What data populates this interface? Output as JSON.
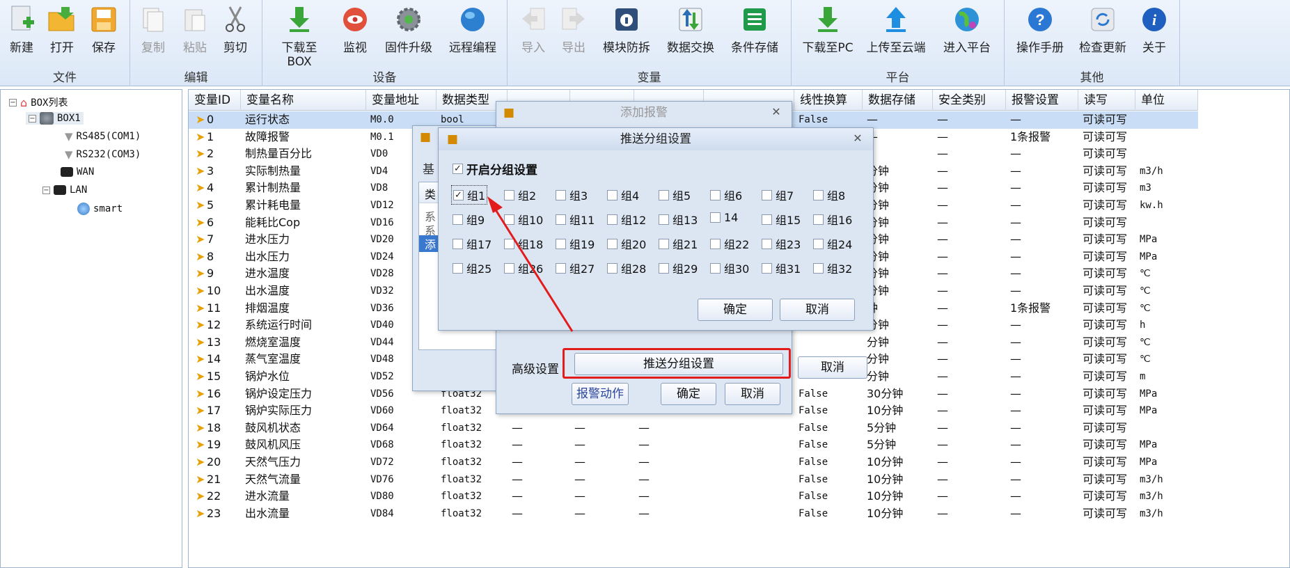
{
  "ribbon": {
    "groups": [
      {
        "name": "文件",
        "buttons": [
          {
            "label": "新建",
            "icon": "new-file-icon"
          },
          {
            "label": "打开",
            "icon": "open-folder-icon"
          },
          {
            "label": "保存",
            "icon": "save-icon"
          }
        ]
      },
      {
        "name": "编辑",
        "buttons": [
          {
            "label": "复制",
            "icon": "copy-icon"
          },
          {
            "label": "粘贴",
            "icon": "paste-icon"
          },
          {
            "label": "剪切",
            "icon": "scissors-icon"
          }
        ]
      },
      {
        "name": "设备",
        "buttons": [
          {
            "label": "下载至BOX",
            "icon": "download-icon"
          },
          {
            "label": "监视",
            "icon": "eye-icon"
          },
          {
            "label": "固件升级",
            "icon": "gear-icon"
          },
          {
            "label": "远程编程",
            "icon": "globe-icon"
          }
        ]
      },
      {
        "name": "变量",
        "buttons": [
          {
            "label": "导入",
            "icon": "import-icon"
          },
          {
            "label": "导出",
            "icon": "export-icon"
          },
          {
            "label": "模块防拆",
            "icon": "lock-icon"
          },
          {
            "label": "数据交换",
            "icon": "exchange-icon"
          },
          {
            "label": "条件存储",
            "icon": "list-icon"
          }
        ]
      },
      {
        "name": "平台",
        "buttons": [
          {
            "label": "下载至PC",
            "icon": "download-icon"
          },
          {
            "label": "上传至云端",
            "icon": "upload-icon"
          },
          {
            "label": "进入平台",
            "icon": "globe-icon"
          }
        ]
      },
      {
        "name": "其他",
        "buttons": [
          {
            "label": "操作手册",
            "icon": "help-icon"
          },
          {
            "label": "检查更新",
            "icon": "refresh-icon"
          },
          {
            "label": "关于",
            "icon": "info-icon"
          }
        ]
      }
    ]
  },
  "tree": {
    "root": "BOX列表",
    "box": "BOX1",
    "children": [
      "RS485(COM1)",
      "RS232(COM3)",
      "WAN",
      "LAN"
    ],
    "lan_child": "smart"
  },
  "grid": {
    "headers": [
      "变量ID",
      "变量名称",
      "变量地址",
      "数据类型",
      "",
      "",
      "",
      "",
      "线性换算",
      "数据存储",
      "安全类别",
      "报警设置",
      "读写",
      "单位"
    ],
    "rows": [
      [
        "0",
        "运行状态",
        "M0.0",
        "bool",
        "",
        "",
        "",
        "",
        "False",
        "—",
        "—",
        "—",
        "可读可写",
        ""
      ],
      [
        "1",
        "故障报警",
        "M0.1",
        "",
        "",
        "",
        "",
        "",
        "",
        "—",
        "—",
        "1条报警",
        "可读可写",
        ""
      ],
      [
        "2",
        "制热量百分比",
        "VD0",
        "",
        "",
        "",
        "",
        "",
        "",
        "",
        "—",
        "—",
        "可读可写",
        ""
      ],
      [
        "3",
        "实际制热量",
        "VD4",
        "",
        "",
        "",
        "",
        "",
        "",
        "分钟",
        "—",
        "—",
        "可读可写",
        "m3/h"
      ],
      [
        "4",
        "累计制热量",
        "VD8",
        "",
        "",
        "",
        "",
        "",
        "",
        "分钟",
        "—",
        "—",
        "可读可写",
        "m3"
      ],
      [
        "5",
        "累计耗电量",
        "VD12",
        "",
        "",
        "",
        "",
        "",
        "",
        "分钟",
        "—",
        "—",
        "可读可写",
        "kw.h"
      ],
      [
        "6",
        "能耗比Cop",
        "VD16",
        "",
        "",
        "",
        "",
        "",
        "",
        "分钟",
        "—",
        "—",
        "可读可写",
        ""
      ],
      [
        "7",
        "进水压力",
        "VD20",
        "",
        "",
        "",
        "",
        "",
        "",
        "分钟",
        "—",
        "—",
        "可读可写",
        "MPa"
      ],
      [
        "8",
        "出水压力",
        "VD24",
        "",
        "",
        "",
        "",
        "",
        "",
        "分钟",
        "—",
        "—",
        "可读可写",
        "MPa"
      ],
      [
        "9",
        "进水温度",
        "VD28",
        "",
        "",
        "",
        "",
        "",
        "",
        "分钟",
        "—",
        "—",
        "可读可写",
        "℃"
      ],
      [
        "10",
        "出水温度",
        "VD32",
        "",
        "",
        "",
        "",
        "",
        "",
        "分钟",
        "—",
        "—",
        "可读可写",
        "℃"
      ],
      [
        "11",
        "排烟温度",
        "VD36",
        "",
        "",
        "",
        "",
        "",
        "",
        "钟",
        "—",
        "1条报警",
        "可读可写",
        "℃"
      ],
      [
        "12",
        "系统运行时间",
        "VD40",
        "",
        "",
        "",
        "",
        "",
        "",
        "分钟",
        "—",
        "—",
        "可读可写",
        "h"
      ],
      [
        "13",
        "燃烧室温度",
        "VD44",
        "",
        "",
        "",
        "",
        "",
        "",
        "分钟",
        "—",
        "—",
        "可读可写",
        "℃"
      ],
      [
        "14",
        "蒸气室温度",
        "VD48",
        "",
        "",
        "",
        "",
        "",
        "",
        "分钟",
        "—",
        "—",
        "可读可写",
        "℃"
      ],
      [
        "15",
        "锅炉水位",
        "VD52",
        "",
        "",
        "",
        "",
        "",
        "",
        "分钟",
        "—",
        "—",
        "可读可写",
        "m"
      ],
      [
        "16",
        "锅炉设定压力",
        "VD56",
        "float32",
        "",
        "",
        "",
        "",
        "False",
        "30分钟",
        "—",
        "—",
        "可读可写",
        "MPa"
      ],
      [
        "17",
        "锅炉实际压力",
        "VD60",
        "float32",
        "",
        "",
        "",
        "",
        "False",
        "10分钟",
        "—",
        "—",
        "可读可写",
        "MPa"
      ],
      [
        "18",
        "鼓风机状态",
        "VD64",
        "float32",
        "—",
        "—",
        "—",
        "",
        "False",
        "5分钟",
        "—",
        "—",
        "可读可写",
        ""
      ],
      [
        "19",
        "鼓风机风压",
        "VD68",
        "float32",
        "—",
        "—",
        "—",
        "",
        "False",
        "5分钟",
        "—",
        "—",
        "可读可写",
        "MPa"
      ],
      [
        "20",
        "天然气压力",
        "VD72",
        "float32",
        "—",
        "—",
        "—",
        "",
        "False",
        "10分钟",
        "—",
        "—",
        "可读可写",
        "MPa"
      ],
      [
        "21",
        "天然气流量",
        "VD76",
        "float32",
        "—",
        "—",
        "—",
        "",
        "False",
        "10分钟",
        "—",
        "—",
        "可读可写",
        "m3/h"
      ],
      [
        "22",
        "进水流量",
        "VD80",
        "float32",
        "—",
        "—",
        "—",
        "",
        "False",
        "10分钟",
        "—",
        "—",
        "可读可写",
        "m3/h"
      ],
      [
        "23",
        "出水流量",
        "VD84",
        "float32",
        "—",
        "—",
        "—",
        "",
        "False",
        "10分钟",
        "—",
        "—",
        "可读可写",
        "m3/h"
      ]
    ]
  },
  "dialog_back": {
    "tab_text": "基",
    "list_header": "类",
    "items": [
      "系",
      "系",
      "添"
    ]
  },
  "dialog_alarm": {
    "title": "添加报警",
    "adv_label": "高级设置",
    "push_btn": "推送分组设置",
    "action_btn": "报警动作",
    "ok": "确定",
    "cancel": "取消",
    "cancel_back": "取消"
  },
  "dialog_push": {
    "title": "推送分组设置",
    "enable_label": "开启分组设置",
    "groups": [
      "组1",
      "组2",
      "组3",
      "组4",
      "组5",
      "组6",
      "组7",
      "组8",
      "组9",
      "组10",
      "组11",
      "组12",
      "组13",
      "14",
      "组15",
      "组16",
      "组17",
      "组18",
      "组19",
      "组20",
      "组21",
      "组22",
      "组23",
      "组24",
      "组25",
      "组26",
      "组27",
      "组28",
      "组29",
      "组30",
      "组31",
      "组32"
    ],
    "ok": "确定",
    "cancel": "取消"
  }
}
